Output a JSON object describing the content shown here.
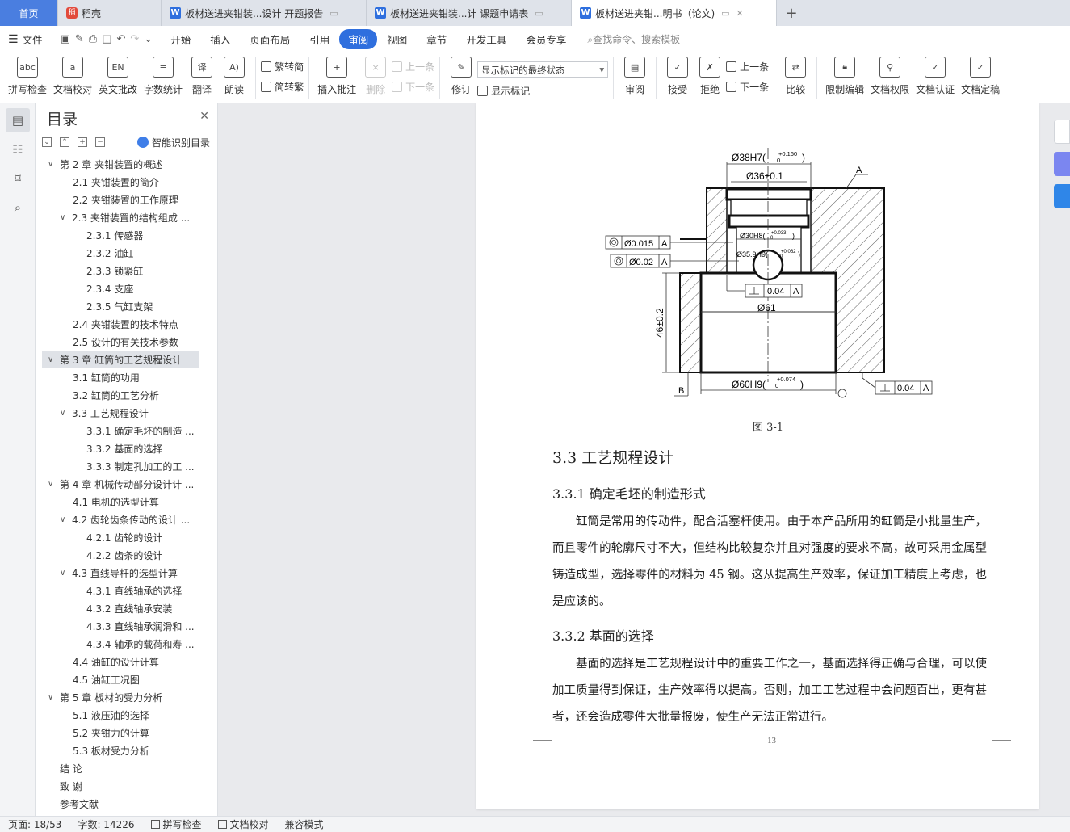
{
  "tabs": [
    {
      "label": "首页"
    },
    {
      "label": "稻壳"
    },
    {
      "label": "板材送进夹钳装...设计 开题报告"
    },
    {
      "label": "板材送进夹钳装...计 课题申请表"
    },
    {
      "label": "板材送进夹钳...明书（论文)"
    }
  ],
  "menu": {
    "file": "文件",
    "items": [
      "开始",
      "插入",
      "页面布局",
      "引用",
      "审阅",
      "视图",
      "章节",
      "开发工具",
      "会员专享"
    ],
    "search": "查找命令、搜索模板"
  },
  "ribbon": {
    "spell": "拼写检查",
    "proof": "文档校对",
    "en_review": "英文批改",
    "wordcount": "字数统计",
    "translate": "翻译",
    "read": "朗读",
    "trad": "繁转简",
    "simp": "简转繁",
    "insert_comment": "插入批注",
    "delete": "删除",
    "prev_c": "上一条",
    "next_c": "下一条",
    "revise": "修订",
    "markup_state": "显示标记的最终状态",
    "show_markup": "显示标记",
    "review": "审阅",
    "accept": "接受",
    "reject": "拒绝",
    "prev": "上一条",
    "next": "下一条",
    "compare": "比较",
    "restrict": "限制编辑",
    "rights": "文档权限",
    "cert": "文档认证",
    "final": "文档定稿"
  },
  "toc": {
    "title": "目录",
    "smart": "智能识别目录",
    "items": [
      {
        "t": "第 2 章  夹钳装置的概述",
        "lv": "l1",
        "arrow": "∨"
      },
      {
        "t": "2.1  夹钳装置的简介",
        "lv": "l2"
      },
      {
        "t": "2.2  夹钳装置的工作原理",
        "lv": "l2"
      },
      {
        "t": "2.3  夹钳装置的结构组成 ...",
        "lv": "l2c",
        "arrow": "∨"
      },
      {
        "t": "2.3.1 传感器",
        "lv": "l3"
      },
      {
        "t": "2.3.2  油缸",
        "lv": "l3"
      },
      {
        "t": "2.3.3  锁紧缸",
        "lv": "l3"
      },
      {
        "t": "2.3.4  支座",
        "lv": "l3"
      },
      {
        "t": "2.3.5  气缸支架",
        "lv": "l3"
      },
      {
        "t": "2.4  夹钳装置的技术特点",
        "lv": "l2"
      },
      {
        "t": "2.5  设计的有关技术参数",
        "lv": "l2"
      },
      {
        "t": "第 3 章  缸筒的工艺规程设计",
        "lv": "l1",
        "arrow": "∨",
        "sel": true
      },
      {
        "t": "3.1  缸筒的功用",
        "lv": "l2"
      },
      {
        "t": "3.2  缸筒的工艺分析",
        "lv": "l2"
      },
      {
        "t": "3.3  工艺规程设计",
        "lv": "l2c",
        "arrow": "∨"
      },
      {
        "t": "3.3.1  确定毛坯的制造 ...",
        "lv": "l3"
      },
      {
        "t": "3.3.2  基面的选择",
        "lv": "l3"
      },
      {
        "t": "3.3.3  制定孔加工的工 ...",
        "lv": "l3"
      },
      {
        "t": "第 4 章  机械传动部分设计计 ...",
        "lv": "l1",
        "arrow": "∨"
      },
      {
        "t": "4.1 电机的选型计算",
        "lv": "l2"
      },
      {
        "t": "4.2 齿轮齿条传动的设计 ...",
        "lv": "l2c",
        "arrow": "∨"
      },
      {
        "t": "4.2.1 齿轮的设计",
        "lv": "l3"
      },
      {
        "t": "4.2.2 齿条的设计",
        "lv": "l3"
      },
      {
        "t": "4.3 直线导杆的选型计算",
        "lv": "l2c",
        "arrow": "∨"
      },
      {
        "t": "4.3.1 直线轴承的选择",
        "lv": "l3"
      },
      {
        "t": "4.3.2 直线轴承安装",
        "lv": "l3"
      },
      {
        "t": "4.3.3 直线轴承润滑和 ...",
        "lv": "l3"
      },
      {
        "t": "4.3.4 轴承的载荷和寿 ...",
        "lv": "l3"
      },
      {
        "t": "4.4 油缸的设计计算",
        "lv": "l2"
      },
      {
        "t": "4.5 油缸工况图",
        "lv": "l2"
      },
      {
        "t": "第 5 章  板材的受力分析",
        "lv": "l1",
        "arrow": "∨"
      },
      {
        "t": "5.1  液压油的选择",
        "lv": "l2"
      },
      {
        "t": "5.2  夹钳力的计算",
        "lv": "l2"
      },
      {
        "t": "5.3  板材受力分析",
        "lv": "l2"
      },
      {
        "t": "结    论",
        "lv": "l1"
      },
      {
        "t": "致    谢",
        "lv": "l1"
      },
      {
        "t": "参考文献",
        "lv": "l1"
      }
    ]
  },
  "drawing": {
    "d38": "Ø38H7(",
    "d38t": "+0.160",
    "d38b": "0",
    "d36": "Ø36±0.1",
    "d30": "Ø30H8(",
    "d30t": "+0.033",
    "d30b": "0",
    "d35": "Ø35.9H9(",
    "d35t": "+0.062",
    "d35b": "0",
    "d61": "Ø61",
    "d60": "Ø60H9(",
    "d60t": "+0.074",
    "d60b": "0",
    "h46": "46±0.2",
    "tol1v": "Ø0.015",
    "tol1d": "A",
    "tol2v": "Ø0.02",
    "tol2d": "A",
    "tol3v": "0.04",
    "tol3d": "A",
    "tol4v": "0.04",
    "tol4d": "A",
    "labA": "A",
    "labB": "B"
  },
  "doc": {
    "caption": "图 3-1",
    "h33": "3.3  工艺规程设计",
    "h331": "3.3.1  确定毛坯的制造形式",
    "p1": "缸筒是常用的传动件，配合活塞杆使用。由于本产品所用的缸筒是小批量生产，而且零件的轮廓尺寸不大，但结构比较复杂并且对强度的要求不高，故可采用金属型铸造成型，选择零件的材料为 45 钢。这从提高生产效率，保证加工精度上考虑，也是应该的。",
    "h332": "3.3.2  基面的选择",
    "p2": "基面的选择是工艺规程设计中的重要工作之一，基面选择得正确与合理，可以使加工质量得到保证，生产效率得以提高。否则，加工工艺过程中会问题百出，更有甚者，还会造成零件大批量报废，使生产无法正常进行。",
    "page_no": "13"
  },
  "status": {
    "page": "页面: 18/53",
    "words": "字数: 14226",
    "spell": "拼写检查",
    "proof": "文档校对",
    "compat": "兼容模式"
  }
}
